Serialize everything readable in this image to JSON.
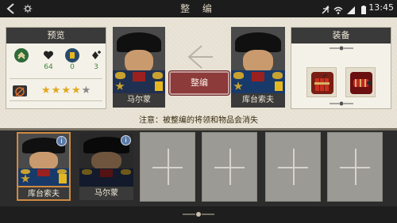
{
  "status_bar": {
    "title": "整 编",
    "time": "13:45"
  },
  "preview": {
    "header": "预览",
    "stats": [
      {
        "icon": "rank-chevron-icon",
        "value": ""
      },
      {
        "icon": "heart-icon",
        "value": "64"
      },
      {
        "icon": "flag-icon",
        "value": "0"
      },
      {
        "icon": "spade-plus-icon",
        "value": "3"
      }
    ],
    "star_rating": 4,
    "star_max": 5
  },
  "generals": {
    "left_name": "马尔蒙",
    "right_name": "库台索夫"
  },
  "reorganize_button": "整编",
  "equipment": {
    "header": "装备",
    "items": [
      "dynamite-icon",
      "cannon-icon"
    ]
  },
  "note": "注意：被整编的将领和物品会消失",
  "roster": [
    {
      "name": "库台索夫",
      "selected": true
    },
    {
      "name": "马尔蒙",
      "selected": false
    }
  ],
  "empty_slots": 4,
  "colors": {
    "accent": "#8c3a3a",
    "selection": "#d08a40",
    "star": "#e0a820",
    "positive": "#3e8a3a"
  }
}
